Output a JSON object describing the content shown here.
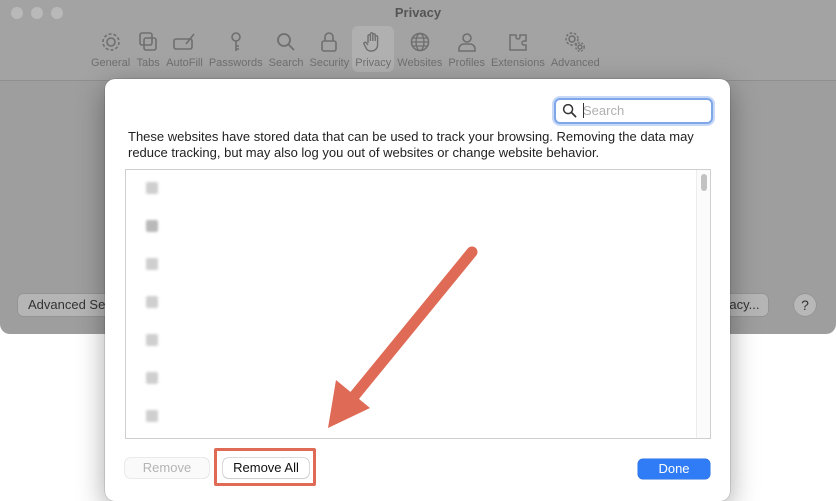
{
  "window": {
    "title": "Privacy",
    "toolbar": [
      {
        "label": "General",
        "icon": "gear-icon"
      },
      {
        "label": "Tabs",
        "icon": "tabs-icon"
      },
      {
        "label": "AutoFill",
        "icon": "autofill-icon"
      },
      {
        "label": "Passwords",
        "icon": "key-icon"
      },
      {
        "label": "Search",
        "icon": "search-icon"
      },
      {
        "label": "Security",
        "icon": "lock-icon"
      },
      {
        "label": "Privacy",
        "icon": "hand-icon",
        "selected": true
      },
      {
        "label": "Websites",
        "icon": "globe-icon"
      },
      {
        "label": "Profiles",
        "icon": "person-icon"
      },
      {
        "label": "Extensions",
        "icon": "puzzle-icon"
      },
      {
        "label": "Advanced",
        "icon": "gears-icon"
      }
    ],
    "advanced_settings_label": "Advanced Se",
    "privacy_report_label": "ivacy...",
    "help_label": "?"
  },
  "sheet": {
    "search_placeholder": "Search",
    "search_value": "",
    "description": "These websites have stored data that can be used to track your browsing. Removing the data may reduce tracking, but may also log you out of websites or change website behavior.",
    "sites": [
      {
        "domain": "",
        "detail": ""
      },
      {
        "domain": "",
        "detail": ""
      },
      {
        "domain": "",
        "detail": ""
      },
      {
        "domain": "",
        "detail": ""
      },
      {
        "domain": "",
        "detail": ""
      },
      {
        "domain": "",
        "detail": ""
      },
      {
        "domain": "",
        "detail": ""
      }
    ],
    "remove_label": "Remove",
    "remove_all_label": "Remove All",
    "done_label": "Done"
  },
  "annotation": {
    "color": "#df6a55"
  }
}
